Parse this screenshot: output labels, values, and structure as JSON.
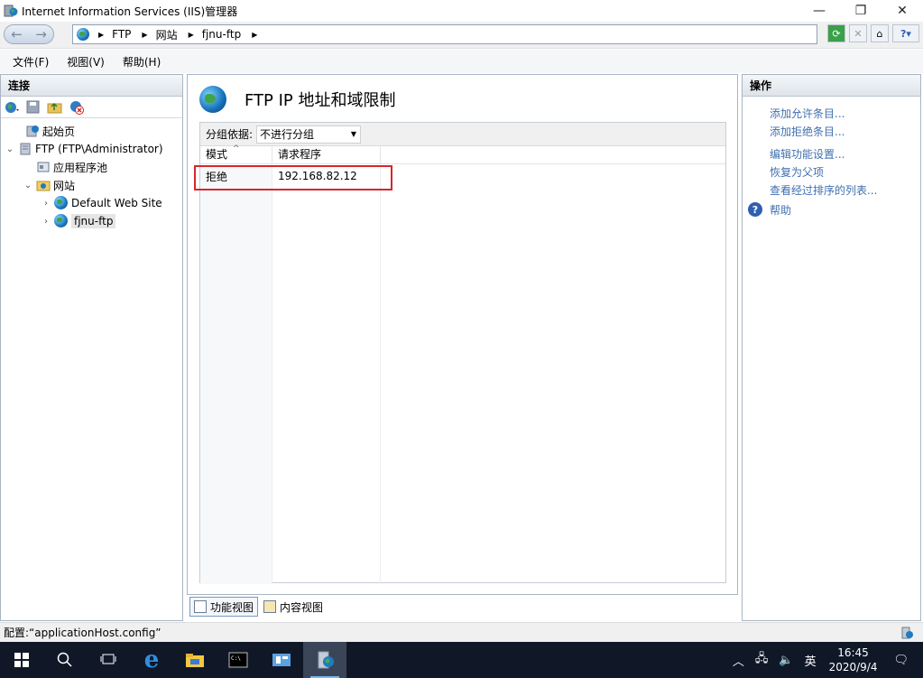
{
  "window": {
    "title": "Internet Information Services (IIS)管理器",
    "minimize": "—",
    "maximize": "❐",
    "close": "✕"
  },
  "address_bar": {
    "back": "←",
    "forward": "→",
    "crumbs": [
      "FTP",
      "网站",
      "fjnu-ftp"
    ]
  },
  "menu": [
    "文件(F)",
    "视图(V)",
    "帮助(H)"
  ],
  "connections": {
    "header": "连接",
    "tree": [
      {
        "label": "起始页",
        "icon": "start-page-icon"
      },
      {
        "label": "FTP (FTP\\Administrator)",
        "icon": "server-icon"
      },
      {
        "label": "应用程序池",
        "icon": "app-pool-icon"
      },
      {
        "label": "网站",
        "icon": "sites-folder-icon"
      },
      {
        "label": "Default Web Site",
        "icon": "globe-icon"
      },
      {
        "label": "fjnu-ftp",
        "icon": "globe-icon"
      }
    ]
  },
  "feature": {
    "title": "FTP IP 地址和域限制",
    "group_by_label": "分组依据:",
    "group_by_value": "不进行分组",
    "columns": [
      "模式",
      "请求程序"
    ],
    "rows": [
      {
        "mode": "拒绝",
        "requester": "192.168.82.12"
      }
    ],
    "view_tabs": [
      "功能视图",
      "内容视图"
    ]
  },
  "actions": {
    "header": "操作",
    "items": [
      "添加允许条目...",
      "添加拒绝条目...",
      "编辑功能设置...",
      "恢复为父项",
      "查看经过排序的列表..."
    ],
    "help": "帮助"
  },
  "status": {
    "text": "配置:“applicationHost.config”"
  },
  "taskbar": {
    "clock_time": "16:45",
    "clock_date": "2020/9/4",
    "ime": "英"
  },
  "colors": {
    "accent_link": "#3f6fb0",
    "highlight_border": "#d9262b",
    "taskbar_bg": "#101828"
  }
}
